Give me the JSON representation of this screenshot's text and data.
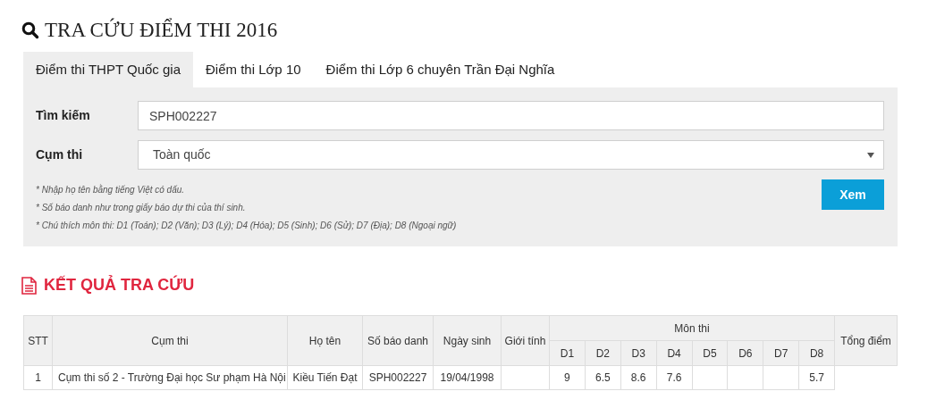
{
  "title": "TRA CỨU ĐIỂM THI 2016",
  "tabs": [
    {
      "label": "Điểm thi THPT Quốc gia",
      "selected": true
    },
    {
      "label": "Điểm thi Lớp 10",
      "selected": false
    },
    {
      "label": "Điểm thi Lớp 6 chuyên Trần Đại Nghĩa",
      "selected": false
    }
  ],
  "form": {
    "search_label": "Tìm kiếm",
    "search_value": "SPH002227",
    "cluster_label": "Cụm thi",
    "cluster_value": "Toàn quốc",
    "notes": [
      "* Nhập họ tên bằng tiếng Việt có dấu.",
      "* Số báo danh như trong giấy báo dự thi của thí sinh.",
      "* Chú thích môn thi: D1 (Toán); D2 (Văn); D3 (Lý); D4 (Hóa); D5 (Sinh); D6 (Sử); D7 (Địa); D8 (Ngoại ngữ)"
    ],
    "submit": "Xem"
  },
  "results": {
    "heading": "KẾT QUẢ TRA CỨU",
    "columns": [
      "STT",
      "Cụm thi",
      "Họ tên",
      "Số báo danh",
      "Ngày sinh",
      "Giới tính"
    ],
    "subjects_group": "Môn thi",
    "subjects": [
      "D1",
      "D2",
      "D3",
      "D4",
      "D5",
      "D6",
      "D7",
      "D8"
    ],
    "total_column": "Tổng điểm",
    "rows": [
      {
        "stt": "1",
        "cluster": "Cụm thi số 2 - Trường Đại học Sư phạm Hà Nội",
        "name": "Kiều Tiến Đạt",
        "candidate_no": "SPH002227",
        "birth_date": "19/04/1998",
        "scores": {
          "d1": "9",
          "d2": "6.5",
          "d3": "8.6",
          "d4": "7.6",
          "d8": "5.7"
        }
      }
    ]
  }
}
